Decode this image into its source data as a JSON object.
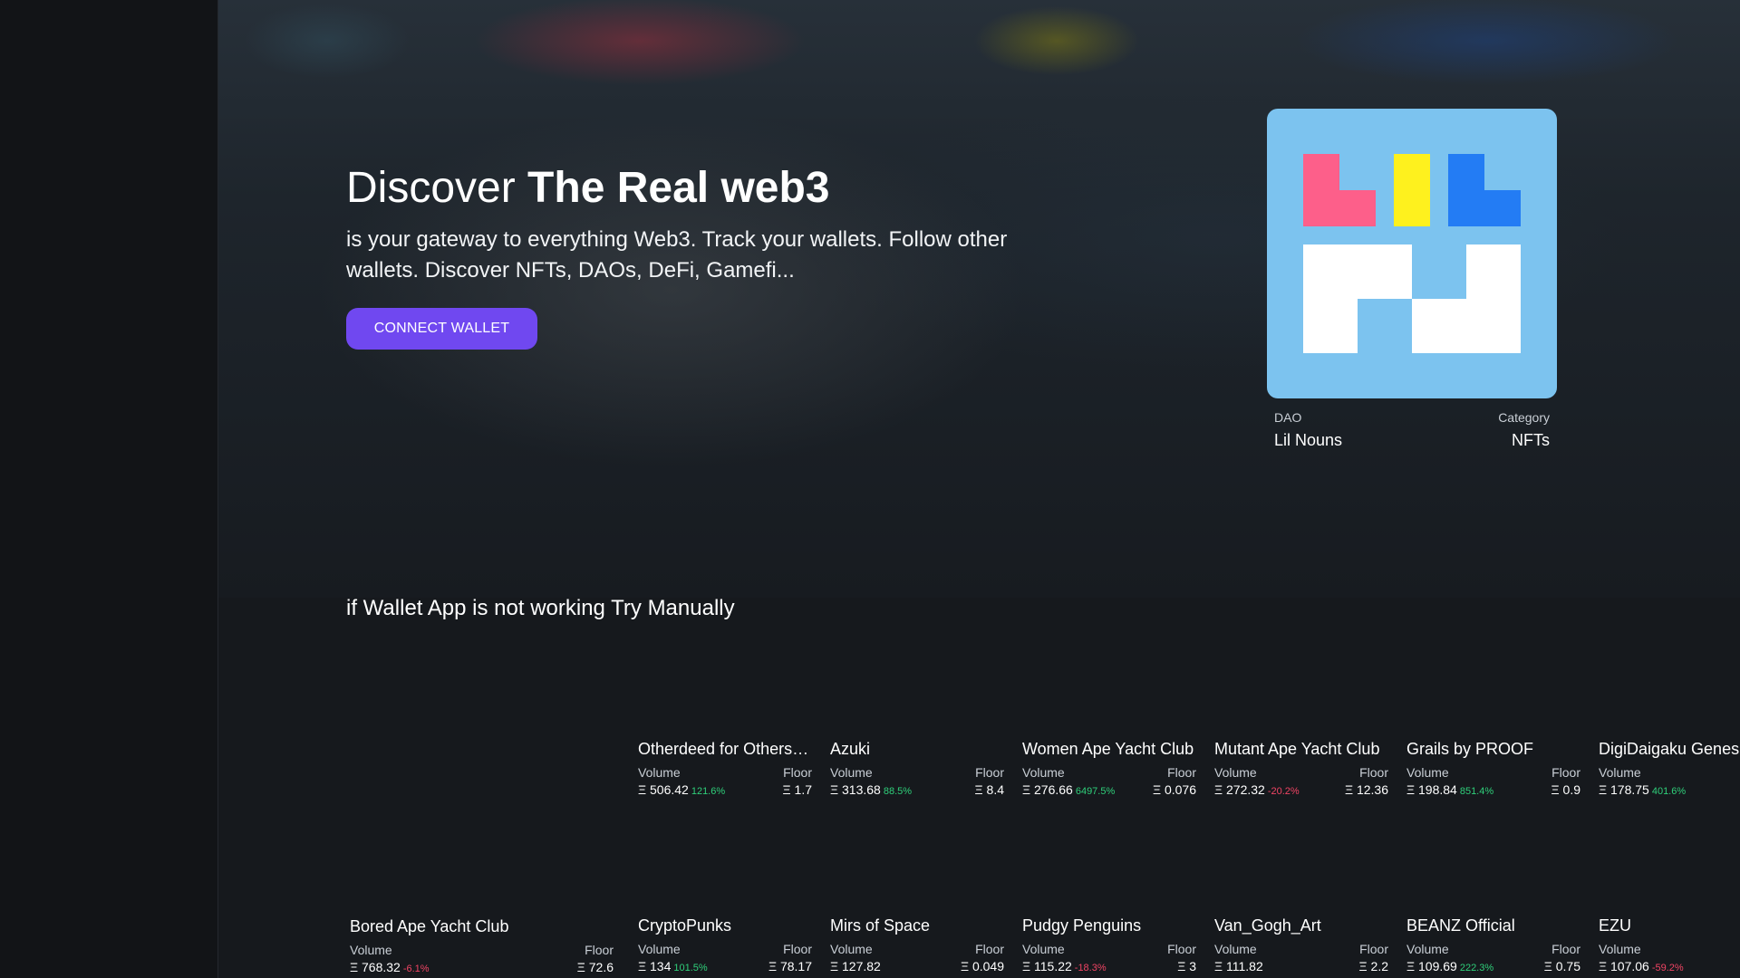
{
  "hero": {
    "title_plain": "Discover ",
    "title_bold": "The Real web3",
    "subtitle": "is your gateway to everything Web3. Track your wallets. Follow other wallets. Discover NFTs, DAOs, DeFi, Gamefi...",
    "connect_label": "CONNECT WALLET"
  },
  "featured": {
    "type_label": "DAO",
    "name": "Lil Nouns",
    "category_label": "Category",
    "category": "NFTs",
    "image_colors": {
      "background": "#7cc3ef",
      "pink": "#fd5f8a",
      "yellow": "#fef11e",
      "blue": "#237cf4",
      "white": "#ffffff"
    }
  },
  "manual_text": "if Wallet App is not working Try Manually",
  "currency_symbol": "Ξ",
  "stat_labels": {
    "volume": "Volume",
    "floor": "Floor"
  },
  "colors": {
    "accent": "#7048f0",
    "positive": "#2fcf7a",
    "negative": "#f04464"
  },
  "collections": [
    {
      "name": "Otherdeed for Others…",
      "volume": "506.42",
      "change": "121.6%",
      "trend": "up",
      "floor": "1.7"
    },
    {
      "name": "Azuki",
      "volume": "313.68",
      "change": "88.5%",
      "trend": "up",
      "floor": "8.4"
    },
    {
      "name": "Women Ape Yacht Club",
      "volume": "276.66",
      "change": "6497.5%",
      "trend": "up",
      "floor": "0.076"
    },
    {
      "name": "Mutant Ape Yacht Club",
      "volume": "272.32",
      "change": "-20.2%",
      "trend": "down",
      "floor": "12.36"
    },
    {
      "name": "Grails by PROOF",
      "volume": "198.84",
      "change": "851.4%",
      "trend": "up",
      "floor": "0.9"
    },
    {
      "name": "DigiDaigaku Genesis",
      "volume": "178.75",
      "change": "401.6%",
      "trend": "up",
      "floor": ""
    },
    {
      "name": "Bored Ape Yacht Club",
      "volume": "768.32",
      "change": "-6.1%",
      "trend": "down",
      "floor": "72.6"
    },
    {
      "name": "CryptoPunks",
      "volume": "134",
      "change": "101.5%",
      "trend": "up",
      "floor": "78.17"
    },
    {
      "name": "Mirs of Space",
      "volume": "127.82",
      "change": "",
      "trend": "",
      "floor": "0.049"
    },
    {
      "name": "Pudgy Penguins",
      "volume": "115.22",
      "change": "-18.3%",
      "trend": "down",
      "floor": "3"
    },
    {
      "name": "Van_Gogh_Art",
      "volume": "111.82",
      "change": "",
      "trend": "",
      "floor": "2.2"
    },
    {
      "name": "BEANZ Official",
      "volume": "109.69",
      "change": "222.3%",
      "trend": "up",
      "floor": "0.75"
    },
    {
      "name": "EZU",
      "volume": "107.06",
      "change": "-59.2%",
      "trend": "down",
      "floor": ""
    }
  ]
}
